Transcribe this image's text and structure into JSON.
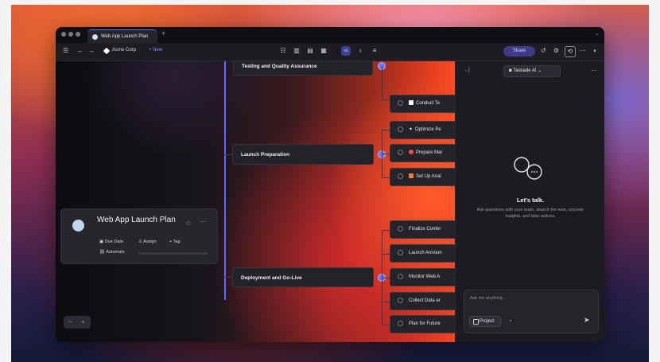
{
  "window": {
    "tab_title": "Web App Launch Plan",
    "new_tab": "+"
  },
  "toolbar": {
    "workspace": "Acme Corp",
    "new_label": "+ New",
    "share_label": "Share"
  },
  "mindmap": {
    "branches": [
      {
        "title": "Testing and Quality Assurance",
        "items": [
          {
            "text": "Conduct Te",
            "marker": "square-white"
          }
        ]
      },
      {
        "title": "Launch Preparation",
        "items": [
          {
            "text": "Optimize Pe",
            "marker": "spark"
          },
          {
            "text": "Prepare Mar",
            "marker": "pin-red"
          },
          {
            "text": "Set Up Anal",
            "marker": "chart-orange"
          }
        ]
      },
      {
        "title": "Deployment and Go-Live",
        "items": [
          {
            "text": "Finalize Conter",
            "marker": ""
          },
          {
            "text": "Launch Announ",
            "marker": ""
          },
          {
            "text": "Monitor Web A",
            "marker": ""
          },
          {
            "text": "Collect Data ar",
            "marker": ""
          },
          {
            "text": "Plan for Future",
            "marker": ""
          }
        ]
      }
    ]
  },
  "card": {
    "title": "Web App Launch Plan",
    "due_date": "Due Date",
    "assign": "Assign",
    "tag": "+ Tag",
    "automate": "Automate"
  },
  "zoom": {
    "minus": "−",
    "plus": "+"
  },
  "ai_panel": {
    "agent_label": "Taskade AI",
    "heading": "Let's talk.",
    "subtitle": "Ask questions with your team, search the web, uncover insights, and take actions.",
    "input_placeholder": "Ask me anything...",
    "project_label": "Project"
  },
  "colors": {
    "accent": "#5a6bff",
    "window_bg": "#17171c",
    "share_bg": "#3f3b8a"
  }
}
